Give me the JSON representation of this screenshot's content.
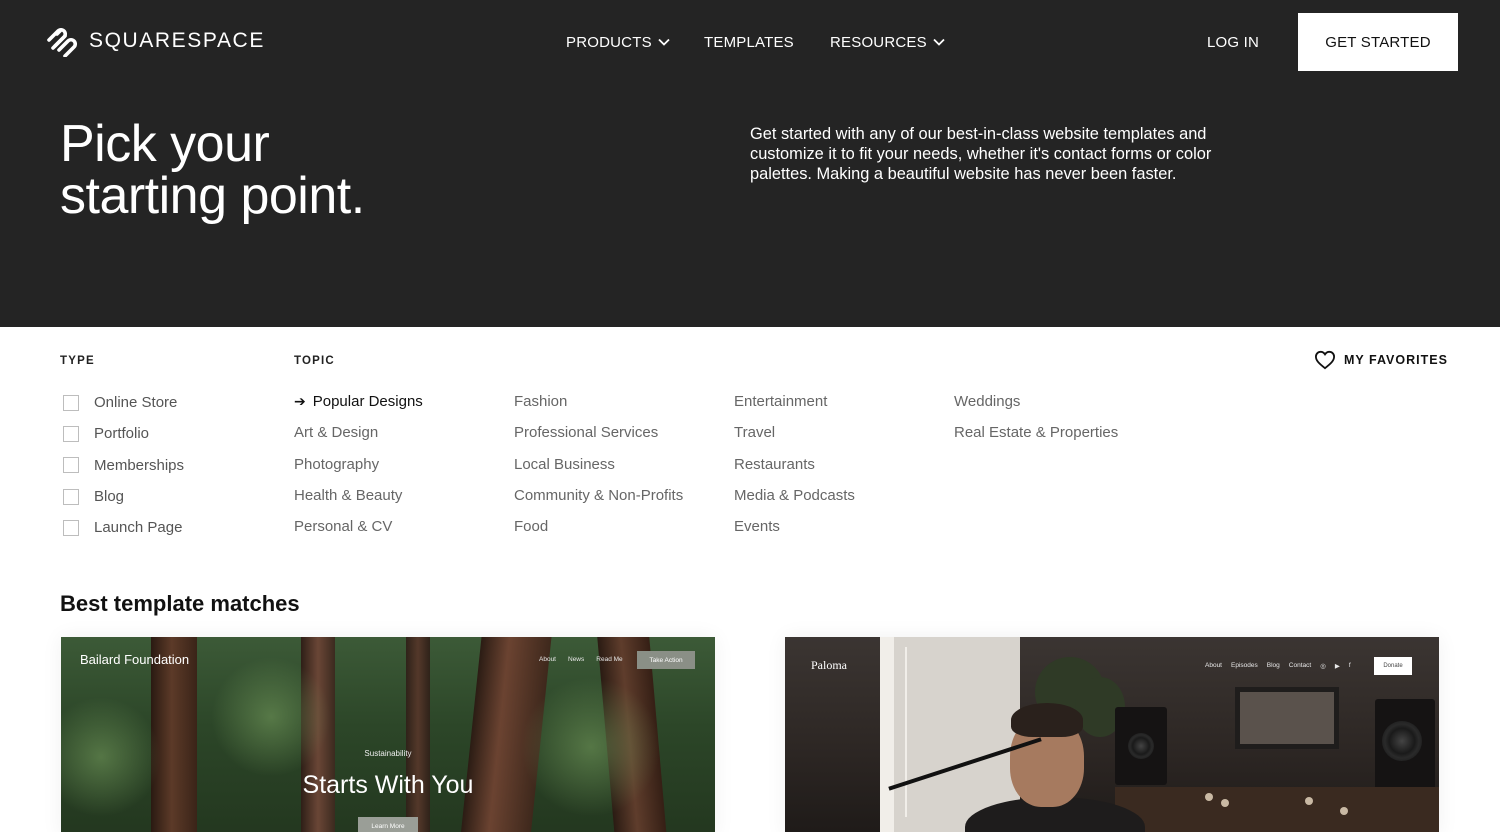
{
  "header": {
    "brand": "SQUARESPACE",
    "nav": [
      {
        "label": "PRODUCTS",
        "has_dropdown": true
      },
      {
        "label": "TEMPLATES",
        "has_dropdown": false
      },
      {
        "label": "RESOURCES",
        "has_dropdown": true
      }
    ],
    "login_label": "LOG IN",
    "cta_label": "GET STARTED"
  },
  "hero": {
    "title_line1": "Pick your",
    "title_line2": "starting point.",
    "description": "Get started with any of our best-in-class website templates and customize it to fit your needs, whether it's contact forms or color palettes. Making a beautiful website has never been faster."
  },
  "filters": {
    "type_label": "TYPE",
    "type_options": [
      {
        "label": "Online Store",
        "checked": false
      },
      {
        "label": "Portfolio",
        "checked": false
      },
      {
        "label": "Memberships",
        "checked": false
      },
      {
        "label": "Blog",
        "checked": false
      },
      {
        "label": "Launch Page",
        "checked": false
      }
    ],
    "topic_label": "TOPIC",
    "topic_columns": [
      [
        "Popular Designs",
        "Art & Design",
        "Photography",
        "Health & Beauty",
        "Personal & CV"
      ],
      [
        "Fashion",
        "Professional Services",
        "Local Business",
        "Community & Non-Profits",
        "Food"
      ],
      [
        "Entertainment",
        "Travel",
        "Restaurants",
        "Media & Podcasts",
        "Events"
      ],
      [
        "Weddings",
        "Real Estate & Properties"
      ]
    ],
    "active_topic": "Popular Designs",
    "favorites_label": "MY FAVORITES"
  },
  "matches": {
    "title": "Best template matches",
    "templates": [
      {
        "brand": "Bailard Foundation",
        "nav": [
          "About",
          "News",
          "Read Me"
        ],
        "button": "Take Action",
        "kicker": "Sustainability",
        "headline": "Starts With You",
        "secondary_button": "Learn More"
      },
      {
        "brand": "Paloma",
        "nav": [
          "About",
          "Episodes",
          "Blog",
          "Contact"
        ],
        "social_icons": [
          "instagram-icon",
          "youtube-icon",
          "facebook-icon"
        ],
        "button": "Donate"
      }
    ]
  },
  "colors": {
    "hero_bg": "#242424",
    "hero_text": "#ffffff",
    "cta_bg": "#ffffff",
    "muted_text": "#666666"
  }
}
